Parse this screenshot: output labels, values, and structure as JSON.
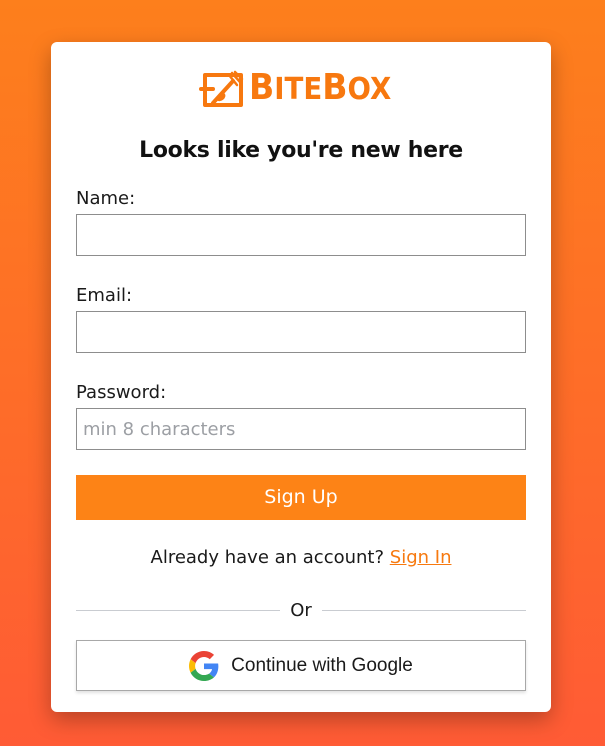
{
  "brand": {
    "name_first": "B",
    "name_rest1": "ITE",
    "name_second": "B",
    "name_rest2": "OX",
    "color": "#f7780f",
    "logo_icon": "food-box-utensils-icon"
  },
  "heading": "Looks like you're new here",
  "form": {
    "name_label": "Name:",
    "name_value": "",
    "email_label": "Email:",
    "email_value": "",
    "password_label": "Password:",
    "password_placeholder": "min 8 characters",
    "password_value": "",
    "submit_label": "Sign Up"
  },
  "account_prompt": {
    "text": "Already have an account?",
    "link_label": "Sign In"
  },
  "divider_label": "Or",
  "google": {
    "label": "Continue with Google",
    "icon": "google-g-icon"
  },
  "colors": {
    "accent": "#fd8316",
    "background_top": "#fd7f1c",
    "background_bottom": "#ff5b35",
    "link": "#f7790f"
  }
}
